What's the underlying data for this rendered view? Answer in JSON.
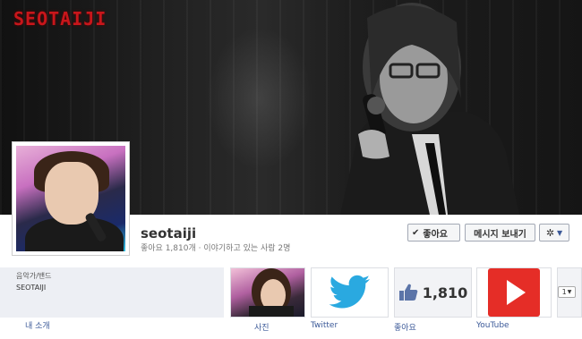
{
  "cover": {
    "logo_text": "SEOTAIJI"
  },
  "page": {
    "name": "seotaiji",
    "stats_line": "좋아요 1,810개 · 이야기하고 있는 사람 2명"
  },
  "actions": {
    "like_label": "좋아요",
    "message_label": "메시지 보내기"
  },
  "about": {
    "category": "음악가/밴드",
    "name": "SEOTAIJI",
    "label": "내 소개"
  },
  "tiles": {
    "photos_label": "사진",
    "twitter_label": "Twitter",
    "likes_count": "1,810",
    "likes_label": "좋아요",
    "youtube_label": "YouTube",
    "more_label": "1"
  },
  "colors": {
    "link": "#3b5998",
    "logo": "#c8161b",
    "youtube": "#e52d27",
    "twitter": "#1da1f2"
  }
}
